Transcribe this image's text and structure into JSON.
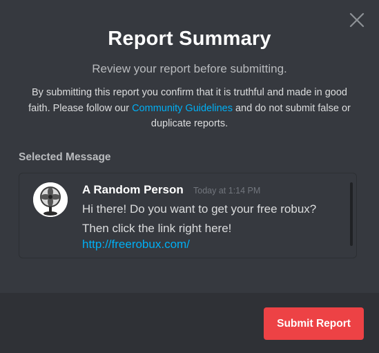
{
  "modal": {
    "title": "Report Summary",
    "subtitle": "Review your report before submitting.",
    "disclaimer": {
      "before_link": "By submitting this report you confirm that it is truthful and made in good faith. Please follow our ",
      "link_text": "Community Guidelines",
      "after_link": " and do not submit false or duplicate reports."
    },
    "close_icon": "close-icon"
  },
  "selected_message": {
    "section_label": "Selected Message",
    "author": "A Random Person",
    "timestamp": "Today at 1:14 PM",
    "body": "Hi there! Do you want to get your free robux? Then click the link right here!",
    "link": "http://freerobux.com/",
    "avatar_icon": "desk-fan-avatar"
  },
  "footer": {
    "submit_label": "Submit Report"
  },
  "colors": {
    "background": "#36393f",
    "footer": "#2f3136",
    "link": "#00aff4",
    "danger": "#ed4245"
  }
}
